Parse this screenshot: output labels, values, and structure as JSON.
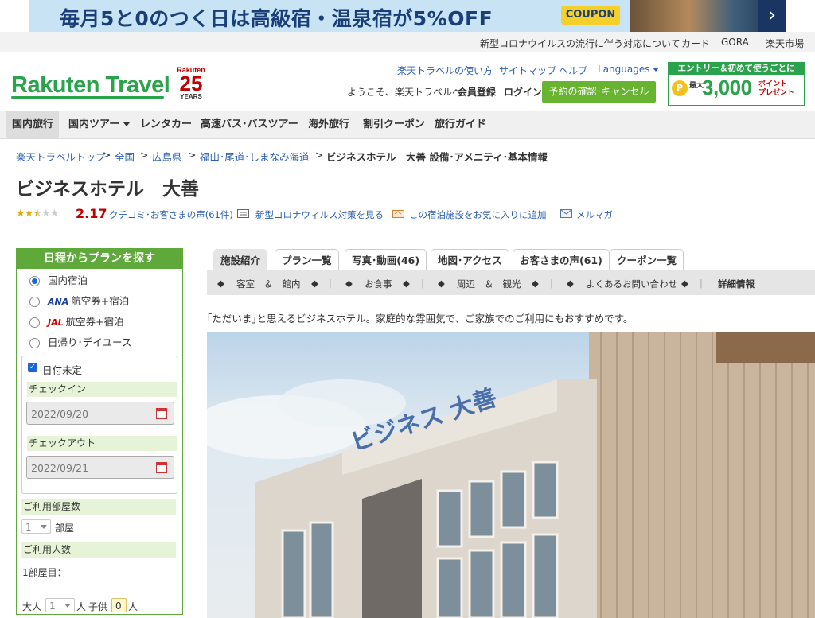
{
  "promo_banner": {
    "text": "毎月5と0のつく日は高級宿・温泉宿が5%OFF",
    "coupon_label": "COUPON",
    "next_label": "›"
  },
  "util_links": [
    "新型コロナウイルスの流行に伴う対応について",
    "カード",
    "GORA",
    "楽天市場"
  ],
  "header": {
    "logo_text": "Rakuten Travel",
    "badge": {
      "top": "Rakuten",
      "number": "25",
      "bottom": "YEARS"
    },
    "links": [
      "楽天トラベルの使い方",
      "サイトマップ",
      "ヘルプ",
      "Languages"
    ],
    "welcome": "ようこそ、楽天トラベルへ",
    "register": "会員登録",
    "login": "ログイン",
    "reservation_button": "予約の確認･キャンセル",
    "entry_banner": {
      "top": "エントリー＆初めて使うごとに",
      "coin": "P",
      "small": "最大",
      "amount": "3,000",
      "points1": "ポイント",
      "points2": "プレゼント"
    }
  },
  "global_nav": [
    "国内旅行",
    "国内ツアー",
    "レンタカー",
    "高速バス･バスツアー",
    "海外旅行",
    "割引クーポン",
    "旅行ガイド"
  ],
  "breadcrumb": {
    "links": [
      "楽天トラベルトップ",
      "全国",
      "広島県",
      "福山･尾道･しまなみ海道"
    ],
    "separator": ">",
    "current": "ビジネスホテル　大善 設備･アメニティ･基本情報"
  },
  "hotel": {
    "name": "ビジネスホテル　大善",
    "rating": 2.17,
    "stars_display": "★★★★★",
    "reviews_link": "クチコミ･お客さまの声(61件)",
    "covid_link": "新型コロナウィルス対策を見る",
    "favorite_link": "この宿泊施設をお気に入りに追加",
    "mailmag_link": "メルマガ"
  },
  "search_panel": {
    "title": "日程からプランを探す",
    "plan_types": [
      {
        "label": "国内宿泊",
        "airline": "",
        "selected": true
      },
      {
        "label": "航空券+宿泊",
        "airline": "ANA",
        "selected": false
      },
      {
        "label": "航空券+宿泊",
        "airline": "JAL",
        "selected": false
      },
      {
        "label": "日帰り･デイユース",
        "airline": "",
        "selected": false
      }
    ],
    "date_undecided_label": "日付未定",
    "date_undecided_checked": true,
    "checkin_label": "チェックイン",
    "checkin_value": "2022/09/20",
    "checkout_label": "チェックアウト",
    "checkout_value": "2022/09/21",
    "rooms_label": "ご利用部屋数",
    "rooms_value": "1",
    "rooms_unit": "部屋",
    "guests_label": "ご利用人数",
    "room1_label": "1部屋目：",
    "adult_label": "大人",
    "adult_value": "1",
    "person_unit": "人",
    "child_label": "子供",
    "child_value": "0",
    "child_unit": "人"
  },
  "tabs": [
    {
      "label": "施設紹介",
      "active": true
    },
    {
      "label": "プラン一覧",
      "active": false
    },
    {
      "label": "写真･動画(46)",
      "active": false
    },
    {
      "label": "地図･アクセス",
      "active": false
    },
    {
      "label": "お客さまの声(61)",
      "active": false
    },
    {
      "label": "クーポン一覧",
      "active": false
    }
  ],
  "sub_nav": [
    "客室　＆　館内",
    "お食事",
    "周辺　＆　観光",
    "よくあるお問い合わせ",
    "詳細情報"
  ],
  "sub_nav_marker": "◆",
  "intro_text": "｢ただいま｣と思えるビジネスホテル。家庭的な雰囲気で、ご家族でのご利用にもおすすめです。",
  "photo_sign": "ビジネス 大善",
  "colors": {
    "rakuten_green": "#2ba24c",
    "panel_green": "#5fa83a",
    "button_green": "#68b32f",
    "link_blue": "#2a5fb0",
    "rating_red": "#bf0000",
    "promo_blue": "#1a3e78"
  }
}
